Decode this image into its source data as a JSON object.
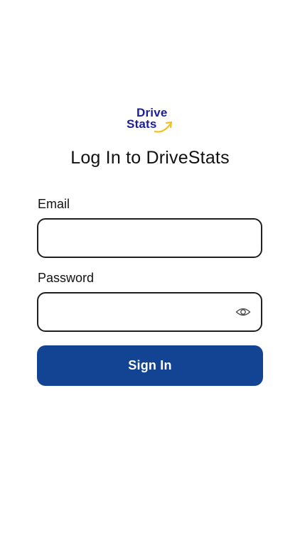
{
  "logo": {
    "line1": "Drive",
    "line2": "Stats",
    "text_color": "#1a1f9c",
    "arrow_color": "#f2c21b",
    "icon": "upward-arrow-icon"
  },
  "title": "Log In to DriveStats",
  "email": {
    "label": "Email",
    "value": "",
    "placeholder": ""
  },
  "password": {
    "label": "Password",
    "value": "",
    "placeholder": "",
    "toggle_icon": "eye-icon"
  },
  "sign_in": {
    "label": "Sign In",
    "color": "#134494"
  }
}
